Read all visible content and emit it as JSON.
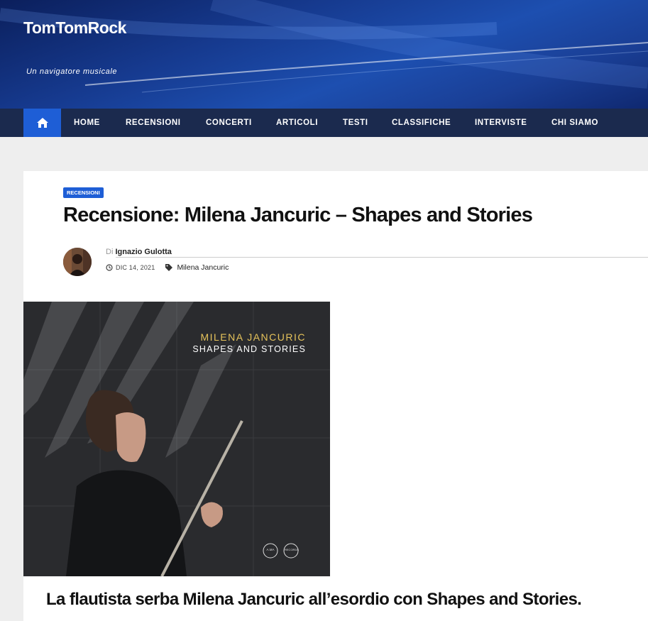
{
  "site": {
    "title": "TomTomRock",
    "tagline": "Un navigatore musicale"
  },
  "nav": {
    "home_icon": "home-icon",
    "items": [
      "HOME",
      "RECENSIONI",
      "CONCERTI",
      "ARTICOLI",
      "TESTI",
      "CLASSIFICHE",
      "INTERVISTE",
      "CHI SIAMO"
    ]
  },
  "post": {
    "category": "RECENSIONI",
    "title": "Recensione: Milena Jancuric – Shapes and Stories",
    "by_prefix": "Di",
    "author": "Ignazio Gulotta",
    "date": "DIC 14, 2021",
    "tag": "Milena Jancuric",
    "cover": {
      "artist": "MILENA JANCURIC",
      "album": "SHAPES AND STORIES",
      "logo1": "A.MA",
      "logo2": "RECORDS"
    },
    "lead": "La flautista serba Milena Jancuric all’esordio con Shapes and Stories."
  },
  "colors": {
    "accent": "#1e5ed6",
    "nav_bg": "#1b2a4e",
    "header_bg": "#1a3f96",
    "cover_text": "#e6c35b"
  }
}
